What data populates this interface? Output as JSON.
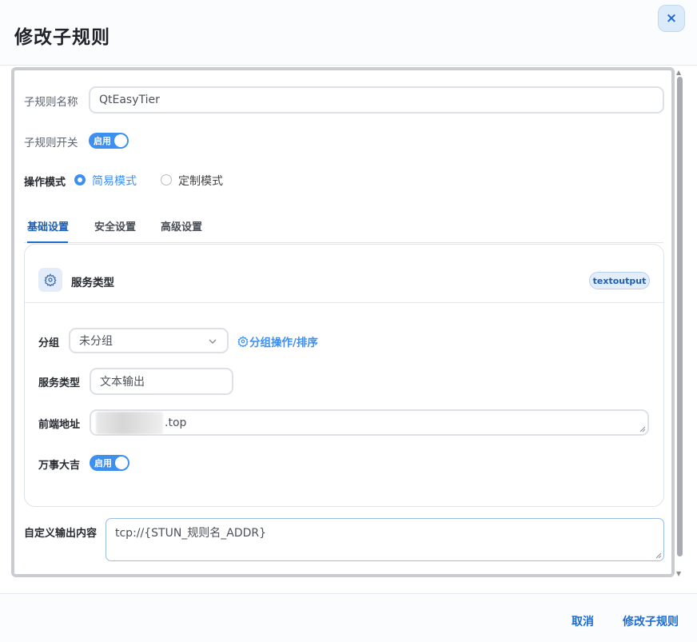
{
  "dialog": {
    "title": "修改子规则",
    "close_icon": "×"
  },
  "form": {
    "name_label": "子规则名称",
    "name_value": "QtEasyTier",
    "switch_label": "子规则开关",
    "switch_state": "启用",
    "mode_label": "操作模式",
    "modes": [
      {
        "label": "简易模式",
        "selected": true
      },
      {
        "label": "定制模式",
        "selected": false
      }
    ],
    "custom_output_label": "自定义输出内容",
    "custom_output_value": "tcp://{STUN_规则名_ADDR}"
  },
  "tabs": [
    {
      "label": "基础设置",
      "active": true
    },
    {
      "label": "安全设置",
      "active": false
    },
    {
      "label": "高级设置",
      "active": false
    }
  ],
  "service_card": {
    "title": "服务类型",
    "badge": "textoutput",
    "group_label": "分组",
    "group_value": "未分组",
    "group_link": "分组操作/排序",
    "service_type_label": "服务类型",
    "service_type_value": "文本输出",
    "frontend_label": "前端地址",
    "frontend_value": ".top",
    "lucky_label": "万事大吉",
    "lucky_state": "启用"
  },
  "footer": {
    "cancel": "取消",
    "submit": "修改子规则"
  },
  "colors": {
    "accent": "#3d8ff0",
    "primary_text": "#1e6bd0",
    "border": "#dde1e6"
  }
}
